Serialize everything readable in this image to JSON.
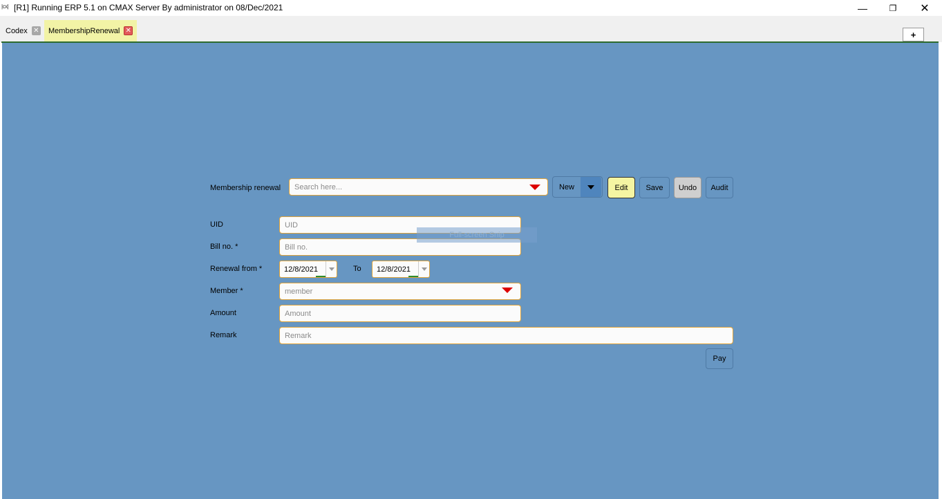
{
  "window": {
    "icon_text": "|cx|",
    "title": "[R1] Running ERP 5.1 on CMAX Server By administrator on 08/Dec/2021",
    "minimize": "—",
    "maximize": "❐",
    "close": "✕"
  },
  "tabs": [
    {
      "label": "Codex",
      "close": "✕"
    },
    {
      "label": "MembershipRenewal",
      "close": "✕"
    }
  ],
  "add_tab_label": "+",
  "form": {
    "membership_renewal_label": "Membership renewal",
    "search_placeholder": "Search here...",
    "buttons": {
      "new": "New",
      "edit": "Edit",
      "save": "Save",
      "undo": "Undo",
      "audit": "Audit",
      "pay": "Pay"
    },
    "uid_label": "UID",
    "uid_placeholder": "UID",
    "bill_label": "Bill no. *",
    "bill_placeholder": "Bill no.",
    "renewal_from_label": "Renewal from *",
    "renewal_from_value": "12/8/2021",
    "to_label": "To",
    "renewal_to_value": "12/8/2021",
    "member_label": "Member *",
    "member_placeholder": "member",
    "amount_label": "Amount",
    "amount_placeholder": "Amount",
    "remark_label": "Remark",
    "remark_placeholder": "Remark"
  },
  "overlay": {
    "snip_text": "Full-screen Snip"
  },
  "colors": {
    "panel_bg": "#6796c2",
    "active_tab": "#f2f3a6",
    "field_border": "#e0a43a",
    "edit_button": "#f5f5a2"
  }
}
